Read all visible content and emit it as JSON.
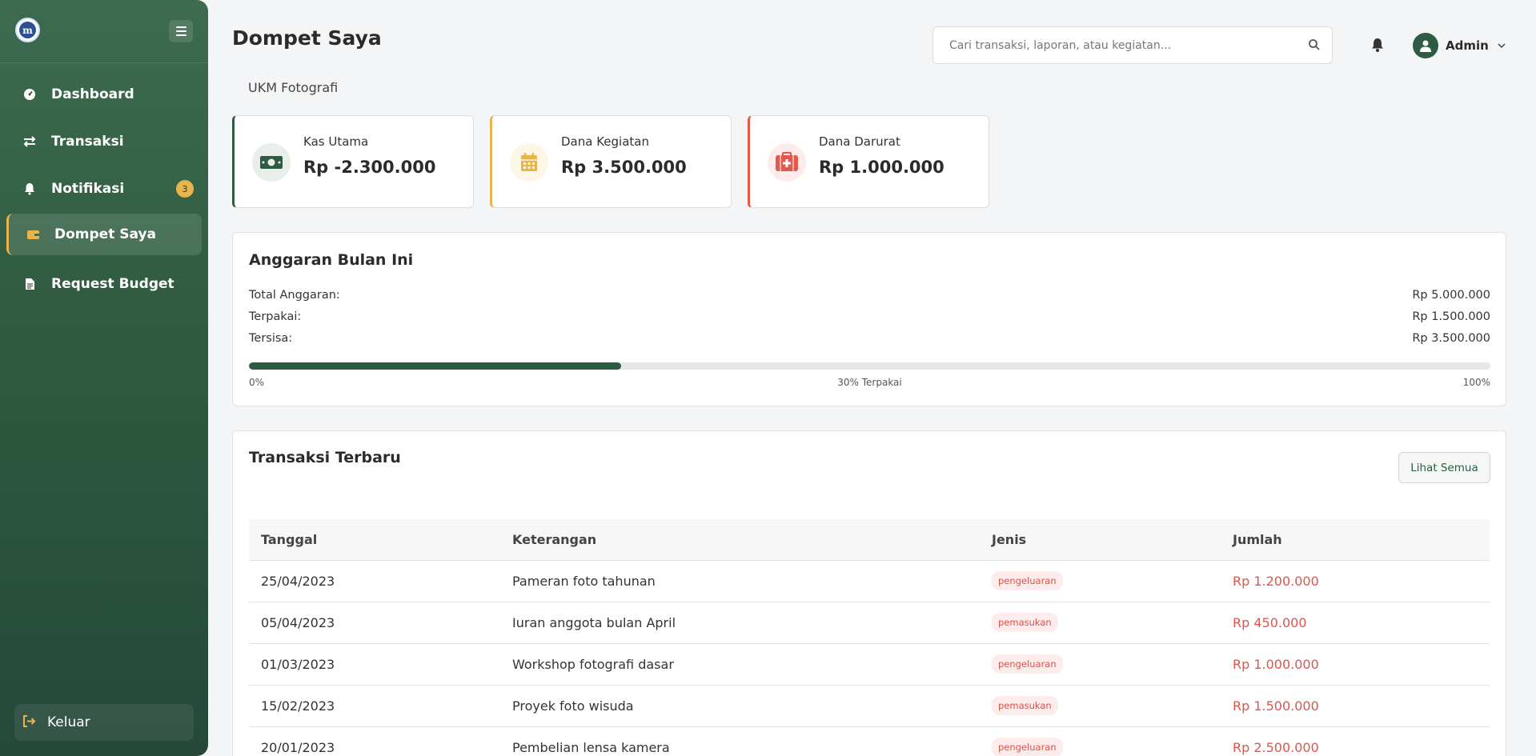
{
  "sidebar": {
    "logo_text": "m",
    "items": [
      {
        "label": "Dashboard",
        "icon": "dashboard-icon"
      },
      {
        "label": "Transaksi",
        "icon": "exchange-icon"
      },
      {
        "label": "Notifikasi",
        "icon": "bell-icon",
        "badge": "3"
      },
      {
        "label": "Dompet Saya",
        "icon": "wallet-icon",
        "active": true
      },
      {
        "label": "Request Budget",
        "icon": "document-icon"
      }
    ],
    "logout_label": "Keluar"
  },
  "header": {
    "title": "Dompet Saya",
    "search_placeholder": "Cari transaksi, laporan, atau kegiatan...",
    "user_name": "Admin"
  },
  "org_name": "UKM Fotografi",
  "wallets": [
    {
      "label": "Kas Utama",
      "value": "Rp -2.300.000",
      "color": "#2e5c42",
      "icon": "money-icon"
    },
    {
      "label": "Dana Kegiatan",
      "value": "Rp 3.500.000",
      "color": "#e8b54d",
      "icon": "calendar-icon"
    },
    {
      "label": "Dana Darurat",
      "value": "Rp 1.000.000",
      "color": "#e05a4f",
      "icon": "first-aid-icon"
    }
  ],
  "budget": {
    "title": "Anggaran Bulan Ini",
    "rows": [
      {
        "label": "Total Anggaran:",
        "value": "Rp 5.000.000"
      },
      {
        "label": "Terpakai:",
        "value": "Rp 1.500.000"
      },
      {
        "label": "Tersisa:",
        "value": "Rp 3.500.000"
      }
    ],
    "progress_fraction": 0.3,
    "progress_min": "0%",
    "progress_mid": "30% Terpakai",
    "progress_max": "100%"
  },
  "transactions": {
    "title": "Transaksi Terbaru",
    "view_all": "Lihat Semua",
    "columns": [
      "Tanggal",
      "Keterangan",
      "Jenis",
      "Jumlah"
    ],
    "rows": [
      {
        "date": "25/04/2023",
        "desc": "Pameran foto tahunan",
        "type": "pengeluaran",
        "amount": "Rp 1.200.000"
      },
      {
        "date": "05/04/2023",
        "desc": "Iuran anggota bulan April",
        "type": "pemasukan",
        "amount": "Rp 450.000"
      },
      {
        "date": "01/03/2023",
        "desc": "Workshop fotografi dasar",
        "type": "pengeluaran",
        "amount": "Rp 1.000.000"
      },
      {
        "date": "15/02/2023",
        "desc": "Proyek foto wisuda",
        "type": "pemasukan",
        "amount": "Rp 1.500.000"
      },
      {
        "date": "20/01/2023",
        "desc": "Pembelian lensa kamera",
        "type": "pengeluaran",
        "amount": "Rp 2.500.000"
      }
    ]
  },
  "colors": {
    "primary": "#2e5c42",
    "accent": "#e8b54d",
    "danger": "#e05a4f"
  }
}
